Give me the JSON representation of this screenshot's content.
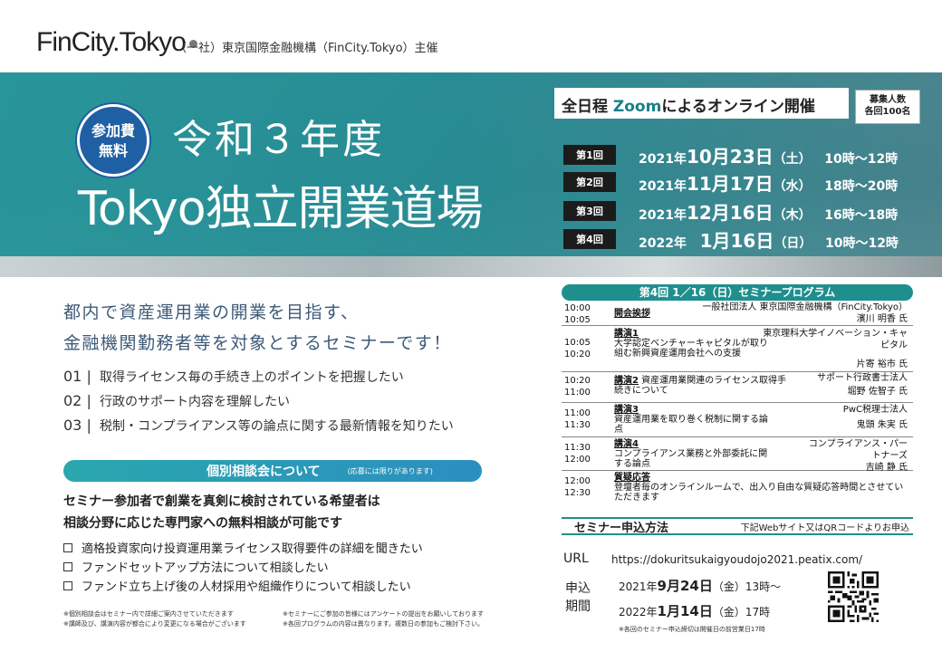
{
  "header": {
    "logo": "FinCity.Tokyo",
    "organizer": "（一社）東京国際金融機構（FinCity.Tokyo）主催"
  },
  "hero": {
    "badge_line1": "参加費",
    "badge_line2": "無料",
    "title_line1": "令和３年度",
    "title_line2": "Tokyo独立開業道場",
    "online_prefix": "全日程",
    "online_zoom": "Zoom",
    "online_mid": "による",
    "online_accent": "オンライン開催",
    "capacity_line1": "募集人数",
    "capacity_line2": "各回100名",
    "sessions": [
      {
        "tag": "第1回",
        "year": "2021年",
        "date": "10月23日",
        "dow": "（土）",
        "time": "10時～12時"
      },
      {
        "tag": "第2回",
        "year": "2021年",
        "date": "11月17日",
        "dow": "（水）",
        "time": "18時～20時"
      },
      {
        "tag": "第3回",
        "year": "2021年",
        "date": "12月16日",
        "dow": "（木）",
        "time": "16時～18時"
      },
      {
        "tag": "第4回",
        "year": "2022年",
        "date": "1月16日",
        "dow": "（日）",
        "time": "10時～12時"
      }
    ]
  },
  "intro": {
    "lead_line1": "都内で資産運用業の開業を目指す、",
    "lead_line2": "金融機関勤務者等を対象とするセミナーです！",
    "points": [
      {
        "no": "01 |",
        "text": "取得ライセンス毎の手続き上のポイントを把握したい"
      },
      {
        "no": "02 |",
        "text": "行政のサポート内容を理解したい"
      },
      {
        "no": "03 |",
        "text": "税制・コンプライアンス等の論点に関する最新情報を知りたい"
      }
    ]
  },
  "consult": {
    "title": "個別相談会について",
    "subtitle": "(応募には限りがあります)",
    "text_line1": "セミナー参加者で創業を真剣に検討されている希望者は",
    "text_line2": "相談分野に応じた専門家への無料相談が可能です",
    "items": [
      "適格投資家向け投資運用業ライセンス取得要件の詳細を聞きたい",
      "ファンドセットアップ方法について相談したい",
      "ファンド立ち上げ後の人材採用や組織作りについて相談したい"
    ],
    "notes": [
      "※個別相談会はセミナー内で詳細ご案内させていただきます",
      "※セミナーにご参加の皆様にはアンケートの提出をお願いしております",
      "※講師及び、講演内容が都合により変更になる場合がございます",
      "※各回プログラムの内容は異なります。複数日の参加もご検討下さい。"
    ]
  },
  "program": {
    "title": "第4回 1／16（日）セミナープログラム",
    "rows": [
      {
        "t1": "10:00",
        "t2": "10:05",
        "label": "開会挨拶",
        "title": "",
        "spk1": "一般社団法人 東京国際金融機構（FinCity.Tokyo）",
        "spk2": "濱川 明香 氏"
      },
      {
        "t1": "10:05",
        "t2": "10:20",
        "label": "講演1",
        "title": "大学認定ベンチャーキャピタルが取り組む新興資産運用会社への支援",
        "spk1": "東京理科大学イノベーション・キャピタル",
        "spk2": "片寄 裕市 氏"
      },
      {
        "t1": "10:20",
        "t2": "11:00",
        "label": "講演2",
        "title": "資産運用業関連のライセンス取得手続きについて",
        "spk1": "サポート行政書士法人",
        "spk2": "堀野 佐智子 氏"
      },
      {
        "t1": "11:00",
        "t2": "11:30",
        "label": "講演3",
        "title": "資産運用業を取り巻く税制に関する論点",
        "spk1": "PwC税理士法人",
        "spk2": "鬼頭 朱実 氏"
      },
      {
        "t1": "11:30",
        "t2": "12:00",
        "label": "講演4",
        "title": "コンプライアンス業務と外部委託に関する論点",
        "spk1": "コンプライアンス・パートナーズ",
        "spk2": "吉崎 静 氏"
      },
      {
        "t1": "12:00",
        "t2": "12:30",
        "label": "質疑応答",
        "title": "登壇者毎のオンラインルームで、出入り自由な質疑応答時間とさせていただきます",
        "spk1": "",
        "spk2": ""
      }
    ]
  },
  "apply": {
    "title": "セミナー申込方法",
    "subtitle": "下記Webサイト又はQRコードよりお申込",
    "url_label": "URL",
    "url": "https://dokuritsukaigyoudojo2021.peatix.com/",
    "period_label": "申込期間",
    "start_year": "2021年",
    "start_date": "9月24日",
    "start_rest": "（金）13時～",
    "end_year": "2022年",
    "end_date": "1月14日",
    "end_rest": "（金）17時",
    "note": "※各回のセミナー申込締切は開催日の前営業日17時"
  }
}
